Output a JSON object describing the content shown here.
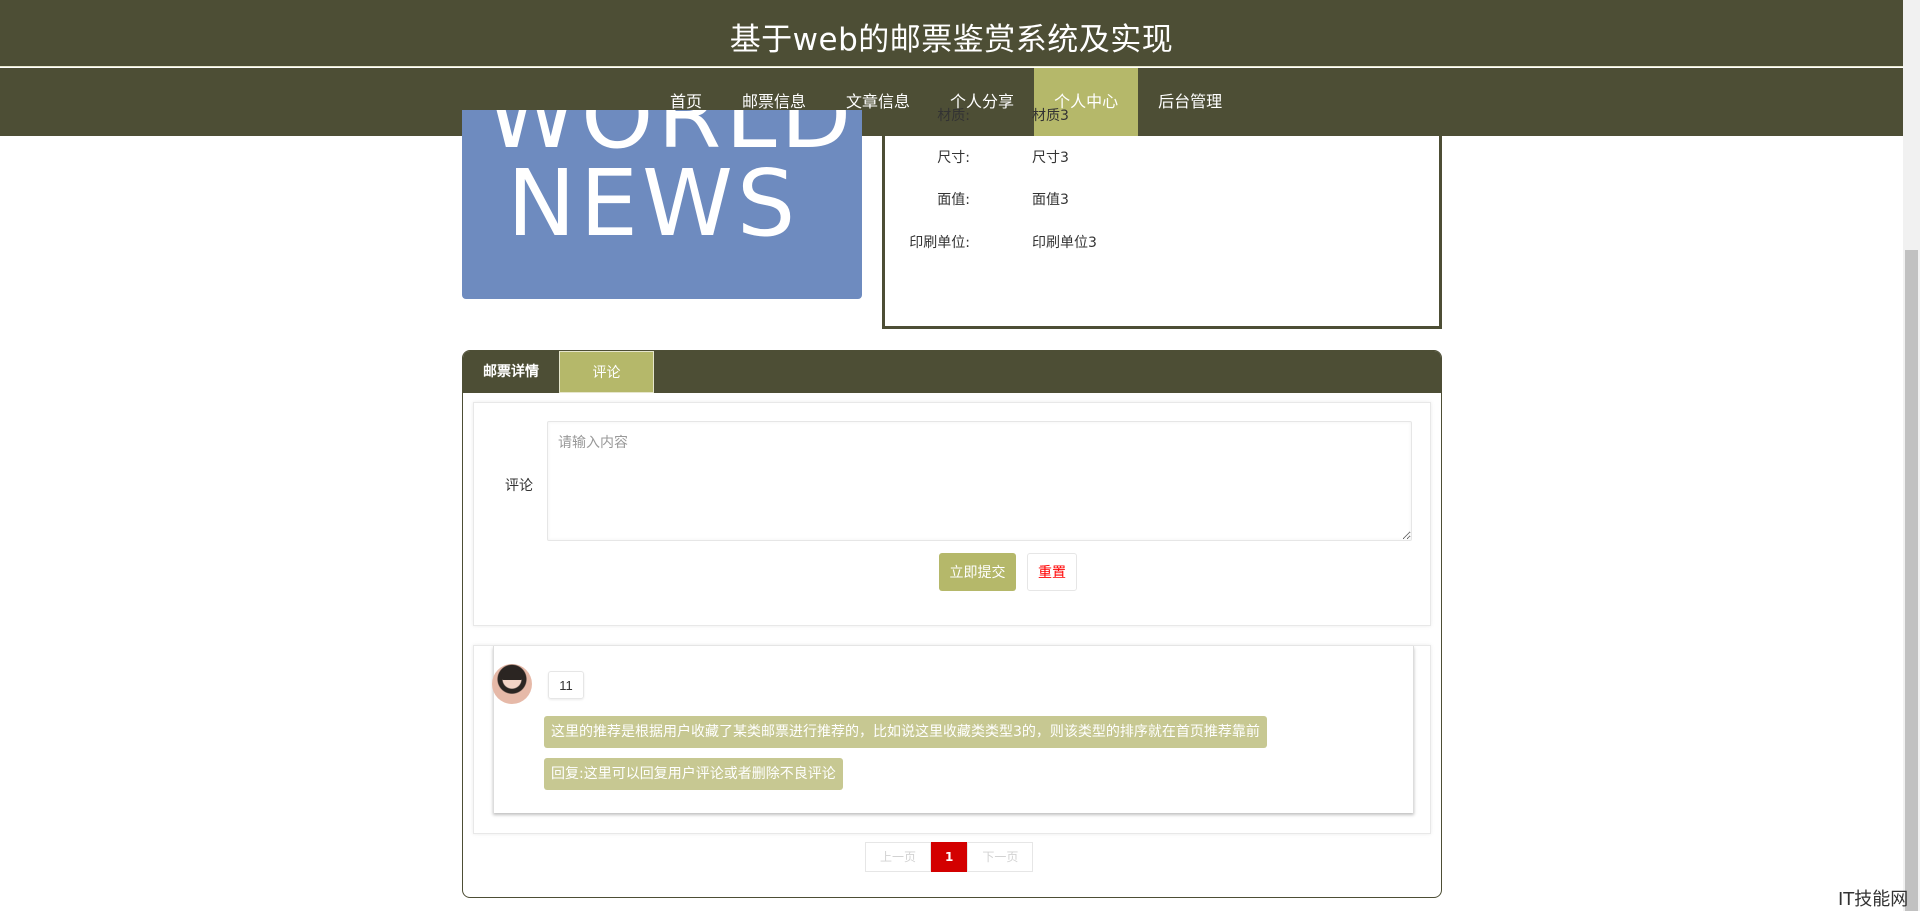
{
  "header": {
    "site_title": "基于web的邮票鉴赏系统及实现"
  },
  "nav": {
    "items": [
      {
        "label": "首页"
      },
      {
        "label": "邮票信息"
      },
      {
        "label": "文章信息"
      },
      {
        "label": "个人分享"
      },
      {
        "label": "个人中心"
      },
      {
        "label": "后台管理"
      }
    ],
    "active": "个人中心"
  },
  "stamp": {
    "image_text": "NEWS",
    "image_text_partial": "WORLD",
    "fields": [
      {
        "label": "材质:",
        "value": "材质3"
      },
      {
        "label": "尺寸:",
        "value": "尺寸3"
      },
      {
        "label": "面值:",
        "value": "面值3"
      },
      {
        "label": "印刷单位:",
        "value": "印刷单位3"
      }
    ]
  },
  "tabs": [
    {
      "label": "邮票详情"
    },
    {
      "label": "评论"
    }
  ],
  "comment_form": {
    "label": "评论",
    "placeholder": "请输入内容",
    "submit_label": "立即提交",
    "reset_label": "重置"
  },
  "comments": [
    {
      "username": "11",
      "content": "这里的推荐是根据用户收藏了某类邮票进行推荐的，比如说这里收藏类类型3的，则该类型的排序就在首页推荐靠前",
      "reply": "回复:这里可以回复用户评论或者删除不良评论"
    }
  ],
  "pagination": {
    "prev": "上一页",
    "current": "1",
    "next": "下一页"
  },
  "watermark": "IT技能网",
  "colors": {
    "primary": "#4d4e35",
    "accent": "#b5b86a",
    "bubble": "#c7c892",
    "page_current": "#d30000"
  }
}
